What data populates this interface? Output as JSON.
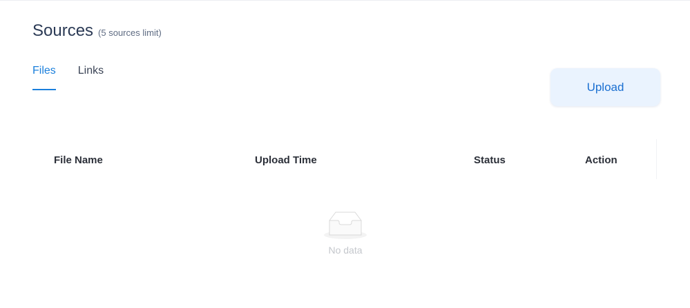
{
  "header": {
    "title": "Sources",
    "subtitle": "(5 sources limit)"
  },
  "tabs": [
    {
      "label": "Files",
      "active": true
    },
    {
      "label": "Links",
      "active": false
    }
  ],
  "toolbar": {
    "upload_label": "Upload"
  },
  "table": {
    "columns": [
      "File Name",
      "Upload Time",
      "Status",
      "Action"
    ],
    "rows": [],
    "empty_text": "No data"
  },
  "colors": {
    "accent": "#1a7fdc",
    "upload_bg": "#eaf3fe",
    "empty_text": "#c4c7cc"
  },
  "icons": {
    "empty": "empty-inbox-icon"
  }
}
